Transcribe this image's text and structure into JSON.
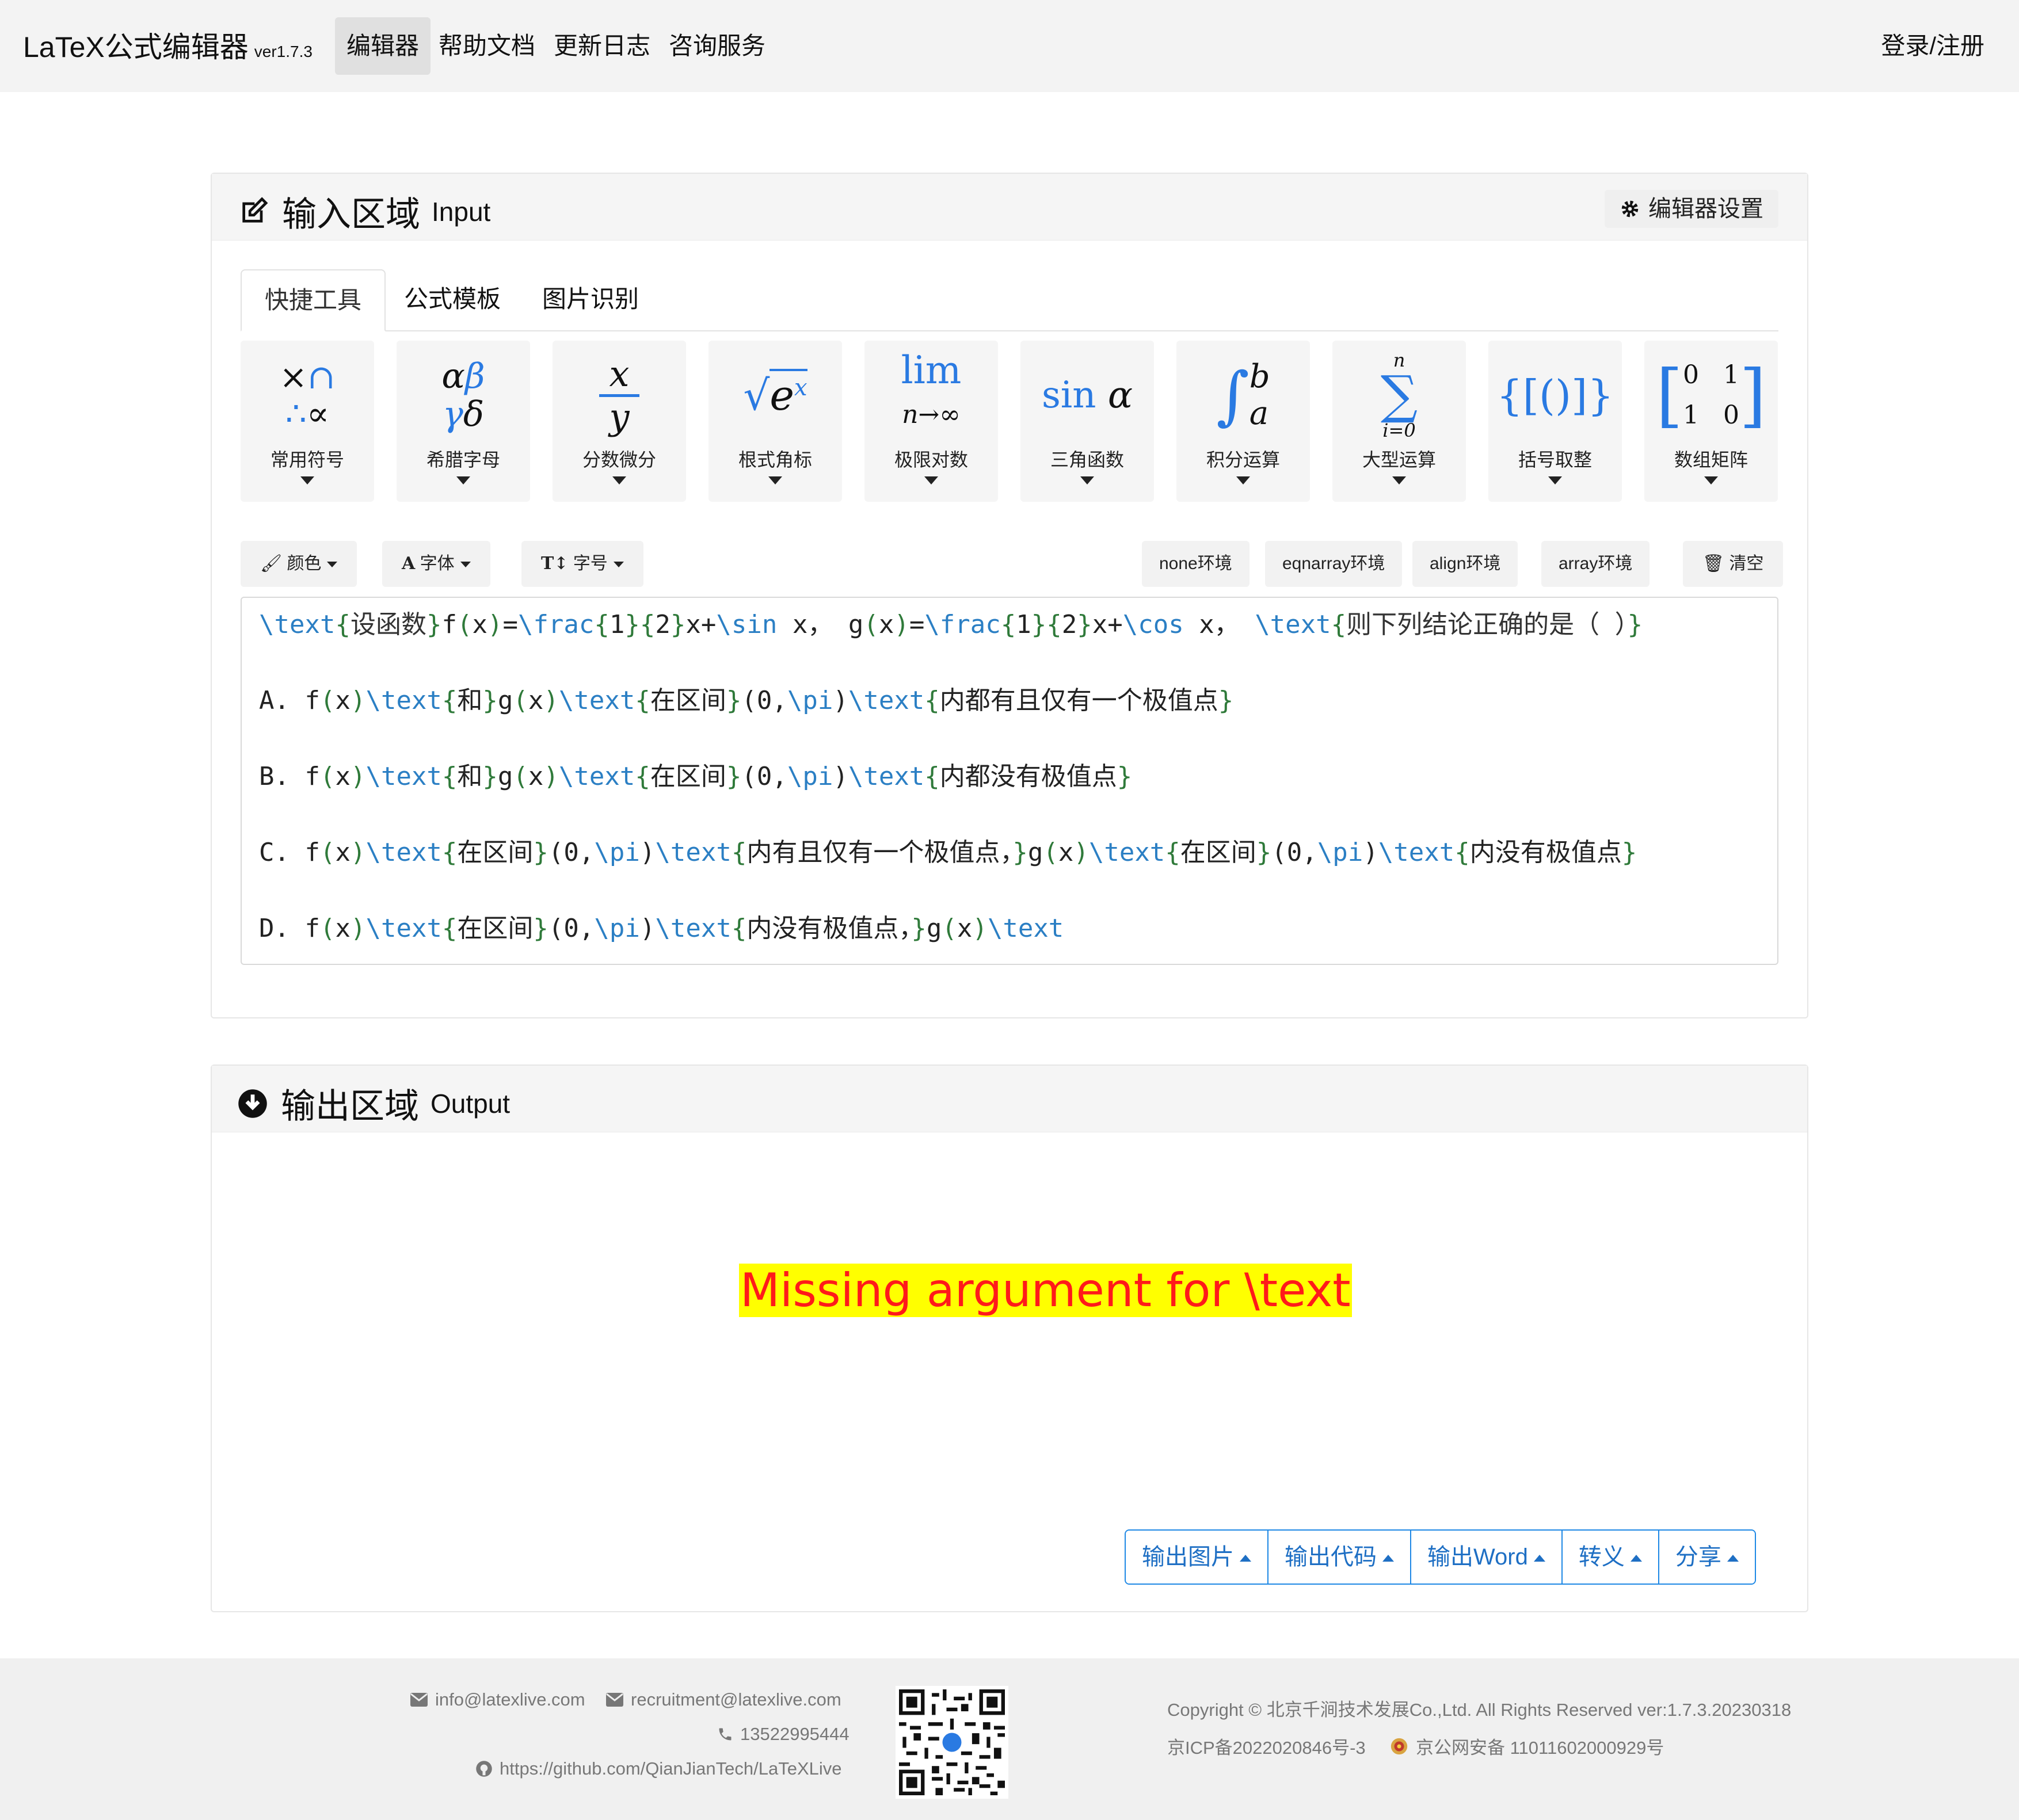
{
  "nav": {
    "brand": "LaTeX公式编辑器",
    "version": "ver1.7.3",
    "items": [
      "编辑器",
      "帮助文档",
      "更新日志",
      "咨询服务"
    ],
    "login": "登录/注册"
  },
  "input_card": {
    "title_cn": "输入区域",
    "title_en": "Input",
    "settings": "编辑器设置",
    "tabs": [
      "快捷工具",
      "公式模板",
      "图片识别"
    ],
    "tools": [
      "常用符号",
      "希腊字母",
      "分数微分",
      "根式角标",
      "极限对数",
      "三角函数",
      "积分运算",
      "大型运算",
      "括号取整",
      "数组矩阵"
    ],
    "format_buttons": {
      "color": "颜色",
      "font": "字体",
      "size": "字号"
    },
    "env_buttons": [
      "none环境",
      "eqnarray环境",
      "align环境",
      "array环境"
    ],
    "clear": "清空"
  },
  "editor": {
    "lines": [
      "\\text{设函数}f(x)=\\frac{1}{2}x+\\sin x, g(x)=\\frac{1}{2}x+\\cos x, \\text{则下列结论正确的是（ ）}",
      "",
      "A. f(x)\\text{和}g(x)\\text{在区间}(0,\\pi)\\text{内都有且仅有一个极值点}",
      "",
      "B. f(x)\\text{和}g(x)\\text{在区间}(0,\\pi)\\text{内都没有极值点}",
      "",
      "C. f(x)\\text{在区间}(0,\\pi)\\text{内有且仅有一个极值点，}g(x)\\text{在区间}(0,\\pi)\\text{内没有极值点}",
      "",
      "D. f(x)\\text{在区间}(0,\\pi)\\text{内没有极值点，}g(x)\\text"
    ]
  },
  "output_card": {
    "title_cn": "输出区域",
    "title_en": "Output",
    "error": "Missing argument for \\text",
    "buttons": [
      "输出图片",
      "输出代码",
      "输出Word",
      "转义",
      "分享"
    ]
  },
  "footer": {
    "email1": "info@latexlive.com",
    "email2": "recruitment@latexlive.com",
    "phone": "13522995444",
    "github": "https://github.com/QianJianTech/LaTeXLive",
    "copyright": "Copyright © 北京千涧技术发展Co.,Ltd. All Rights Reserved   ver:1.7.3.20230318",
    "icp": "京ICP备2022020846号-3",
    "police": "京公网安备 11011602000929号"
  },
  "colors": {
    "accent": "#1e88e5",
    "keyword": "#2b7fc4",
    "brace": "#2f7a3a",
    "error_text": "#ff1a1a",
    "error_bg": "#ffff00"
  }
}
